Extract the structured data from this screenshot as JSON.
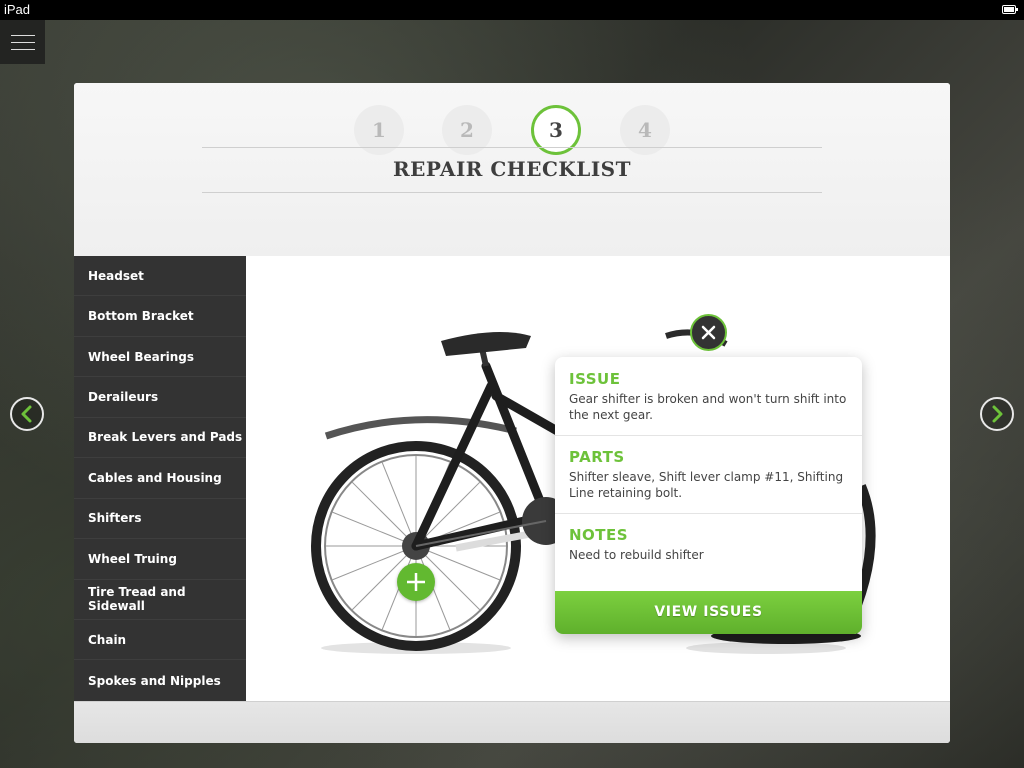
{
  "status_bar": {
    "device": "iPad"
  },
  "steps": [
    "1",
    "2",
    "3",
    "4"
  ],
  "active_step": "3",
  "page_title": "REPAIR CHECKLIST",
  "sidebar": {
    "items": [
      "Headset",
      "Bottom Bracket",
      "Wheel Bearings",
      "Deraileurs",
      "Break Levers and Pads",
      "Cables and Housing",
      "Shifters",
      "Wheel Truing",
      "Tire Tread and Sidewall",
      "Chain",
      "Spokes and Nipples"
    ]
  },
  "popover": {
    "issue_heading": "ISSUE",
    "issue_text": "Gear shifter is broken and won't turn shift into the next gear.",
    "parts_heading": "PARTS",
    "parts_text": "Shifter sleave, Shift lever clamp #11, Shifting Line retaining bolt.",
    "notes_heading": "NOTES",
    "notes_text": "Need to rebuild shifter",
    "button_label": "VIEW ISSUES"
  },
  "colors": {
    "accent": "#6dc23a",
    "sidebar_bg": "#333333"
  },
  "icons": [
    "menu-icon",
    "arrow-left-icon",
    "arrow-right-icon",
    "close-icon",
    "plus-icon",
    "battery-icon"
  ]
}
